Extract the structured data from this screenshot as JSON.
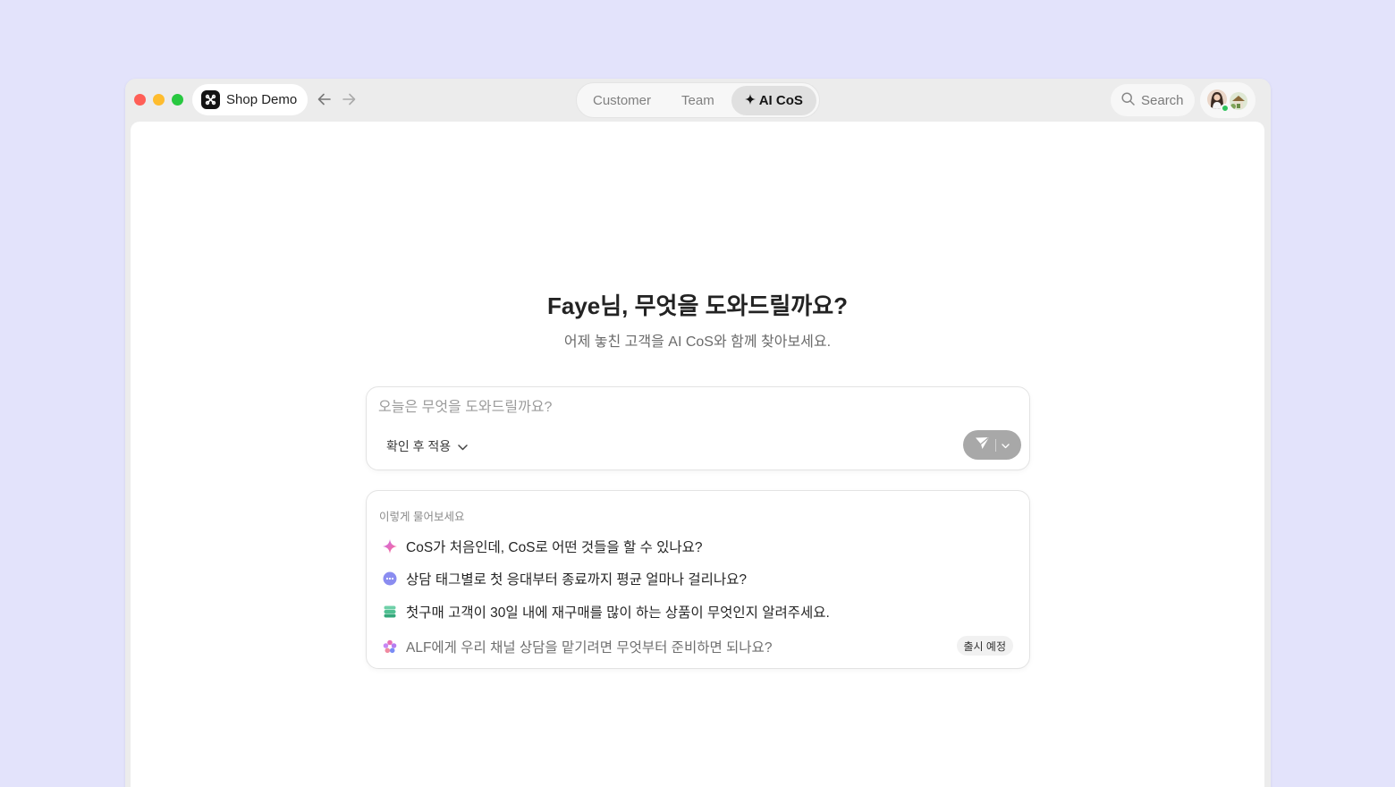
{
  "titlebar": {
    "workspace_name": "Shop Demo",
    "tabs": [
      {
        "label": "Customer"
      },
      {
        "label": "Team"
      },
      {
        "label": "AI CoS",
        "icon": "sparkle-icon"
      }
    ],
    "search_label": "Search"
  },
  "main": {
    "greeting": "Faye님, 무엇을 도와드릴까요?",
    "subtitle": "어제 놓친 고객을 AI CoS와 함께 찾아보세요.",
    "composer": {
      "placeholder": "오늘은 무엇을 도와드릴까요?",
      "mode_label": "확인 후 적용"
    },
    "suggestions": {
      "title": "이렇게 물어보세요",
      "items": [
        {
          "text": "CoS가 처음인데, CoS로 어떤 것들을 할 수 있나요?",
          "icon": "sparkle-icon"
        },
        {
          "text": "상담 태그별로 첫 응대부터 종료까지 평균 얼마나 걸리나요?",
          "icon": "chat-bubble-icon"
        },
        {
          "text": "첫구매 고객이 30일 내에 재구매를 많이 하는 상품이 무엇인지 알려주세요.",
          "icon": "database-icon"
        },
        {
          "text": "ALF에게 우리 채널 상담을 맡기려면 무엇부터 준비하면 되나요?",
          "icon": "flower-icon",
          "badge": "출시 예정"
        }
      ]
    }
  },
  "colors": {
    "background": "#e3e3fb",
    "send_button": "#a8a8a8",
    "online": "#2ec25b"
  }
}
